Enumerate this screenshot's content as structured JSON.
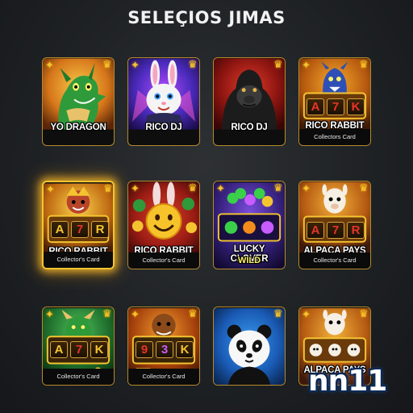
{
  "header": {
    "title": "SELEÇIOS JIMAS"
  },
  "cards": [
    {
      "name": "YO DRAGON",
      "sub": "",
      "footer": ""
    },
    {
      "name": "RICO DJ",
      "sub": "",
      "footer": ""
    },
    {
      "name": "RICO DJ",
      "sub": "",
      "footer": ""
    },
    {
      "name": "RICO RABBIT",
      "sub": "",
      "footer": "Collectors Card",
      "reels": [
        "A",
        "7",
        "K"
      ]
    },
    {
      "name": "RICO RABBIT",
      "sub": "",
      "footer": "Collector's Card",
      "reels": [
        "A",
        "7",
        "R"
      ],
      "highlighted": true
    },
    {
      "name": "RICO RABBIT",
      "sub": "",
      "footer": "Collector's Card"
    },
    {
      "name": "LUCKY CLOVER",
      "sub": "WILD",
      "footer": ""
    },
    {
      "name": "ALPACA PAYS",
      "sub": "",
      "footer": "Collector's Card",
      "reels": [
        "A",
        "7",
        "R"
      ]
    },
    {
      "name": "",
      "sub": "",
      "footer": "Collector's Card",
      "reels": [
        "A",
        "7",
        "K"
      ]
    },
    {
      "name": "",
      "sub": "",
      "footer": "Collector's Card",
      "reels": [
        "9",
        "3",
        "K"
      ]
    },
    {
      "name": "",
      "sub": "",
      "footer": ""
    },
    {
      "name": "ALPACA PAYS",
      "sub": "",
      "footer": ""
    }
  ],
  "watermark": "nn11",
  "colors": {
    "gold_border": "#b58a2c",
    "highlight_glow": "#f4c430",
    "background": "#1f2225"
  }
}
